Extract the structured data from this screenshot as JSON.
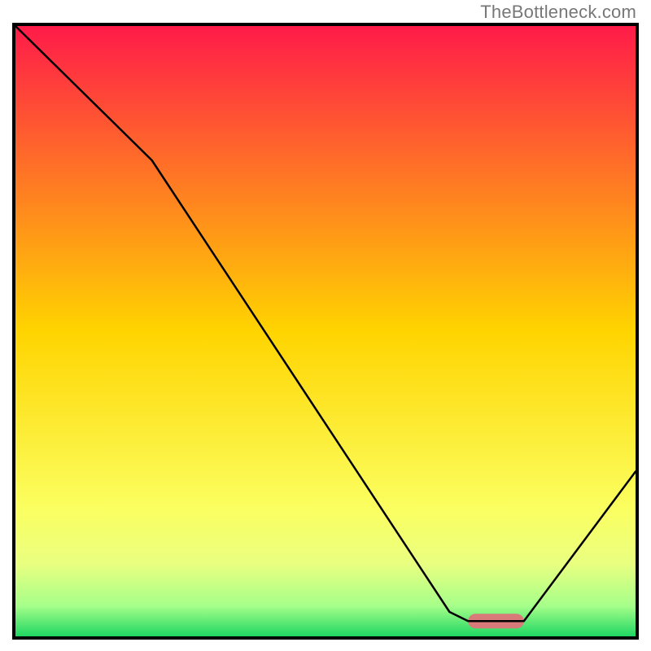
{
  "watermark": "TheBottleneck.com",
  "chart_data": {
    "type": "line",
    "title": "",
    "xlabel": "",
    "ylabel": "",
    "xlim": [
      0,
      100
    ],
    "ylim": [
      0,
      100
    ],
    "grid": false,
    "legend": false,
    "background": {
      "stops": [
        {
          "pct": 0,
          "color": "#ff1b49"
        },
        {
          "pct": 50,
          "color": "#ffd400"
        },
        {
          "pct": 79,
          "color": "#fbff60"
        },
        {
          "pct": 88,
          "color": "#eaff80"
        },
        {
          "pct": 95,
          "color": "#a6ff8a"
        },
        {
          "pct": 100,
          "color": "#1fd662"
        }
      ]
    },
    "series": [
      {
        "name": "curve",
        "color": "#000000",
        "width": 2.5,
        "points_xy": [
          [
            0,
            100
          ],
          [
            22,
            78
          ],
          [
            70,
            4
          ],
          [
            73,
            2.5
          ],
          [
            82,
            2.5
          ],
          [
            100,
            27
          ]
        ]
      }
    ],
    "marker": {
      "color": "#d87a7a",
      "x_range": [
        73,
        82
      ],
      "y": 2.5,
      "height_pct": 2.4
    }
  }
}
